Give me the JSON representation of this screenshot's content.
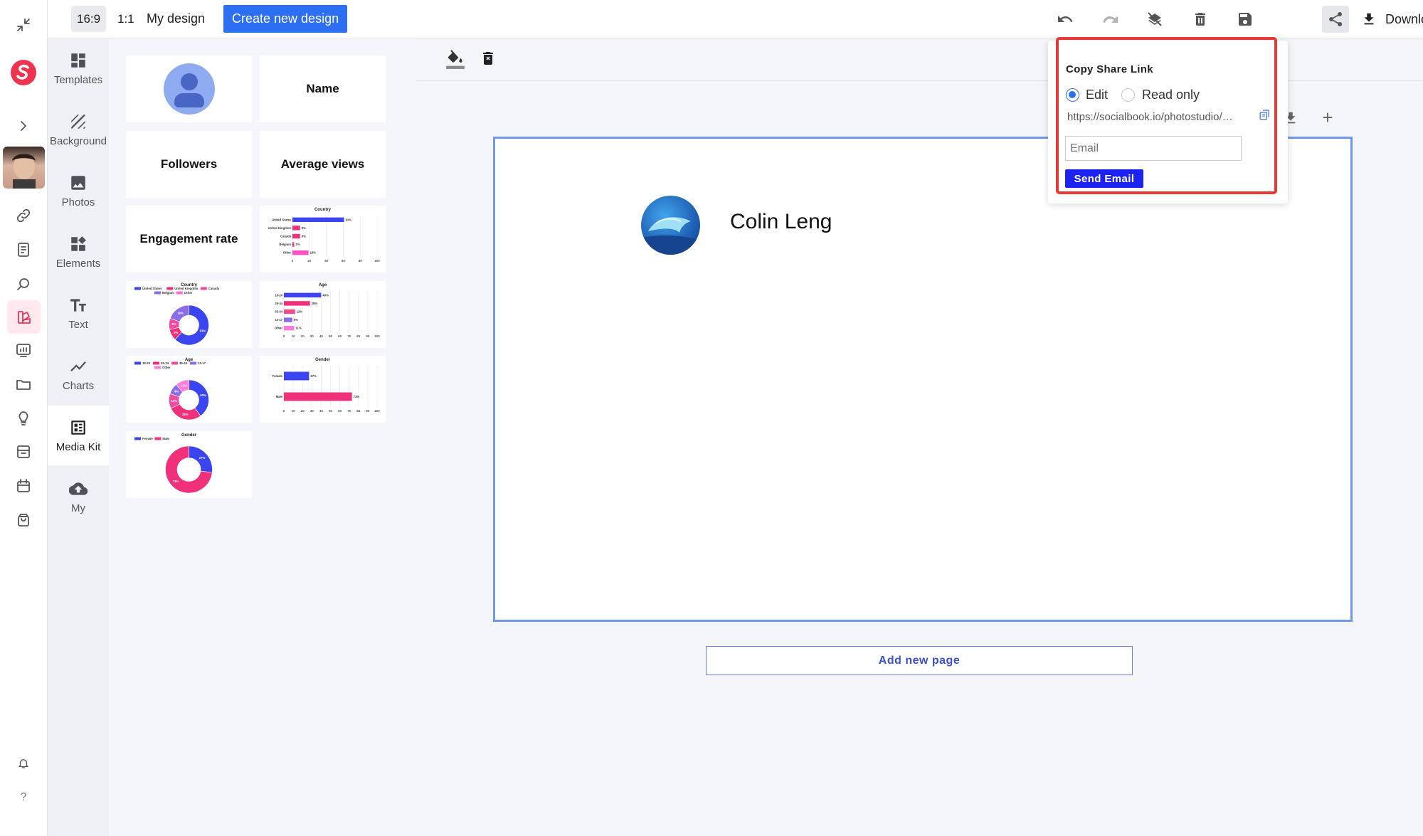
{
  "topbar": {
    "ratio_16_9": "16:9",
    "ratio_1_1": "1:1",
    "my_design": "My design",
    "create_new": "Create new design",
    "download": "Download"
  },
  "tools": [
    {
      "label": "Templates"
    },
    {
      "label": "Background"
    },
    {
      "label": "Photos"
    },
    {
      "label": "Elements"
    },
    {
      "label": "Text"
    },
    {
      "label": "Charts"
    },
    {
      "label": "Media Kit"
    },
    {
      "label": "My"
    }
  ],
  "panel": {
    "name_card": "Name",
    "followers_card": "Followers",
    "avg_views_card": "Average views",
    "engagement_card": "Engagement rate",
    "country_bar": {
      "title": "Country",
      "categories": [
        "United States",
        "United Kingdom",
        "Canada",
        "Belgium",
        "Other"
      ],
      "values": [
        "61%",
        "9%",
        "9%",
        "2%",
        "19%"
      ],
      "ticks": [
        "0",
        "20",
        "40",
        "60",
        "80",
        "100"
      ]
    },
    "country_donut": {
      "title": "Country",
      "legend": [
        "United States",
        "United Kingdom",
        "Canada",
        "Belgium",
        "Other"
      ],
      "labels": [
        "61%",
        "9%",
        "9%",
        "19%"
      ]
    },
    "age_bar": {
      "title": "Age",
      "categories": [
        "18-24",
        "25-34",
        "35-44",
        "13-17",
        "Other"
      ],
      "values": [
        "40%",
        "28%",
        "12%",
        "9%",
        "11%"
      ],
      "ticks": [
        "0",
        "10",
        "20",
        "30",
        "40",
        "50",
        "60",
        "70",
        "80",
        "90",
        "100"
      ]
    },
    "age_donut": {
      "title": "Age",
      "legend": [
        "18-24",
        "25-34",
        "35-44",
        "13-17",
        "Other"
      ],
      "labels": [
        "40%",
        "28%",
        "12%",
        "9%",
        "11%"
      ]
    },
    "gender_bar": {
      "title": "Gender",
      "categories": [
        "Female",
        "Male"
      ],
      "values": [
        "27%",
        "73%"
      ],
      "ticks": [
        "0",
        "10",
        "20",
        "30",
        "40",
        "50",
        "60",
        "70",
        "80",
        "90",
        "100"
      ]
    },
    "gender_donut": {
      "title": "Gender",
      "legend": [
        "Female",
        "Male"
      ],
      "labels": [
        "27%",
        "73%"
      ]
    }
  },
  "canvas": {
    "profile_name": "Colin Leng",
    "add_page": "Add new page"
  },
  "share": {
    "title": "Copy Share Link",
    "edit": "Edit",
    "read_only": "Read only",
    "selected": "Edit",
    "url": "https://socialbook.io/photostudio/design/share",
    "email_placeholder": "Email",
    "send": "Send Email"
  },
  "colors": {
    "accent_blue": "#2c6ff3",
    "chart_blue": "#3a45f0",
    "chart_pink": "#f0307a",
    "highlight_red": "#e53935"
  }
}
